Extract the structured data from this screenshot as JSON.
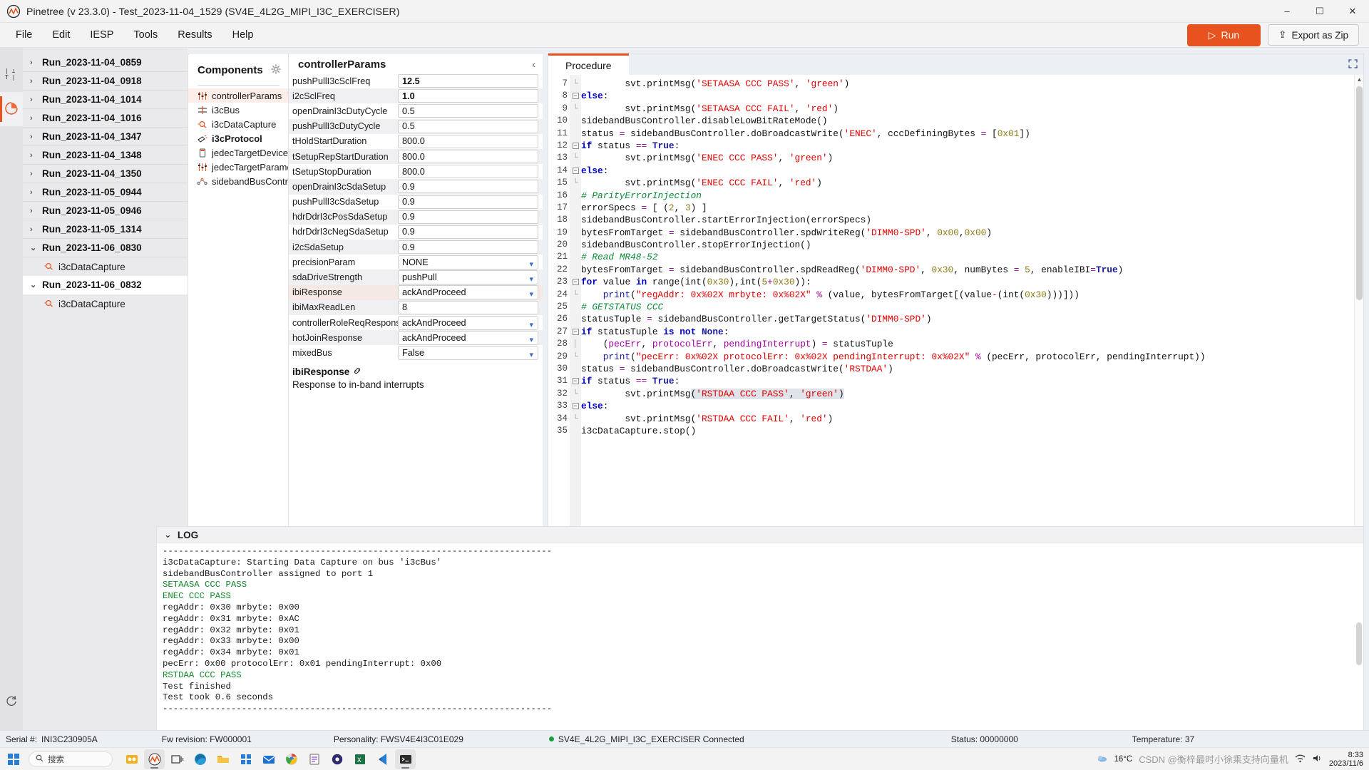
{
  "window": {
    "title": "Pinetree (v 23.3.0) - Test_2023-11-04_1529 (SV4E_4L2G_MIPI_I3C_EXERCISER)",
    "minimize": "–",
    "maximize": "☐",
    "close": "✕"
  },
  "menu": {
    "items": [
      "File",
      "Edit",
      "IESP",
      "Tools",
      "Results",
      "Help"
    ],
    "run_label": "Run",
    "export_label": "Export as Zip"
  },
  "rail": {
    "items": [
      {
        "name": "signal-settings-icon",
        "label": ""
      },
      {
        "name": "results-pie-icon",
        "label": ""
      }
    ],
    "bottom": [
      {
        "name": "refresh-icon"
      },
      {
        "name": "document-icon"
      }
    ]
  },
  "runtree": {
    "runs": [
      {
        "label": "Run_2023-11-04_0859",
        "expanded": false,
        "selected": false,
        "children": []
      },
      {
        "label": "Run_2023-11-04_0918",
        "expanded": false,
        "selected": false,
        "children": []
      },
      {
        "label": "Run_2023-11-04_1014",
        "expanded": false,
        "selected": false,
        "children": []
      },
      {
        "label": "Run_2023-11-04_1016",
        "expanded": false,
        "selected": false,
        "children": []
      },
      {
        "label": "Run_2023-11-04_1347",
        "expanded": false,
        "selected": false,
        "children": []
      },
      {
        "label": "Run_2023-11-04_1348",
        "expanded": false,
        "selected": false,
        "children": []
      },
      {
        "label": "Run_2023-11-04_1350",
        "expanded": false,
        "selected": false,
        "children": []
      },
      {
        "label": "Run_2023-11-05_0944",
        "expanded": false,
        "selected": false,
        "children": []
      },
      {
        "label": "Run_2023-11-05_0946",
        "expanded": false,
        "selected": false,
        "children": []
      },
      {
        "label": "Run_2023-11-05_1314",
        "expanded": false,
        "selected": false,
        "children": []
      },
      {
        "label": "Run_2023-11-06_0830",
        "expanded": true,
        "selected": false,
        "children": [
          "i3cDataCapture"
        ]
      },
      {
        "label": "Run_2023-11-06_0832",
        "expanded": true,
        "selected": true,
        "children": [
          "i3cDataCapture"
        ]
      }
    ]
  },
  "components": {
    "title": "Components",
    "gear_icon": "gear-icon",
    "items": [
      {
        "label": "controllerParams",
        "icon": "sliders-icon",
        "highlighted": true,
        "bold": false,
        "trash": true
      },
      {
        "label": "i3cBus",
        "icon": "bus-icon",
        "highlighted": false,
        "bold": false,
        "trash": false
      },
      {
        "label": "i3cDataCapture",
        "icon": "capture-icon",
        "highlighted": false,
        "bold": false,
        "trash": false
      },
      {
        "label": "i3cProtocol",
        "icon": "protocol-icon",
        "highlighted": false,
        "bold": true,
        "trash": false
      },
      {
        "label": "jedecTargetDevice",
        "icon": "device-icon",
        "highlighted": false,
        "bold": false,
        "trash": false
      },
      {
        "label": "jedecTargetParameters",
        "icon": "sliders-icon",
        "highlighted": false,
        "bold": false,
        "trash": false
      },
      {
        "label": "sidebandBusController",
        "icon": "network-icon",
        "highlighted": false,
        "bold": false,
        "trash": false
      }
    ]
  },
  "params": {
    "title": "controllerParams",
    "collapse_icon": "chevron-left-icon",
    "rows": [
      {
        "name": "pushPullI3cSclFreq",
        "value": "12.5",
        "type": "text",
        "bold": true,
        "highlighted": false
      },
      {
        "name": "i2cSclFreq",
        "value": "1.0",
        "type": "text",
        "bold": true,
        "highlighted": false
      },
      {
        "name": "openDrainI3cDutyCycle",
        "value": "0.5",
        "type": "text",
        "bold": false,
        "highlighted": false
      },
      {
        "name": "pushPullI3cDutyCycle",
        "value": "0.5",
        "type": "text",
        "bold": false,
        "highlighted": false
      },
      {
        "name": "tHoldStartDuration",
        "value": "800.0",
        "type": "text",
        "bold": false,
        "highlighted": false
      },
      {
        "name": "tSetupRepStartDuration",
        "value": "800.0",
        "type": "text",
        "bold": false,
        "highlighted": false
      },
      {
        "name": "tSetupStopDuration",
        "value": "800.0",
        "type": "text",
        "bold": false,
        "highlighted": false
      },
      {
        "name": "openDrainI3cSdaSetup",
        "value": "0.9",
        "type": "text",
        "bold": false,
        "highlighted": false
      },
      {
        "name": "pushPullI3cSdaSetup",
        "value": "0.9",
        "type": "text",
        "bold": false,
        "highlighted": false
      },
      {
        "name": "hdrDdrI3cPosSdaSetup",
        "value": "0.9",
        "type": "text",
        "bold": false,
        "highlighted": false
      },
      {
        "name": "hdrDdrI3cNegSdaSetup",
        "value": "0.9",
        "type": "text",
        "bold": false,
        "highlighted": false
      },
      {
        "name": "i2cSdaSetup",
        "value": "0.9",
        "type": "text",
        "bold": false,
        "highlighted": false
      },
      {
        "name": "precisionParam",
        "value": "NONE",
        "type": "select",
        "bold": false,
        "highlighted": false
      },
      {
        "name": "sdaDriveStrength",
        "value": "pushPull",
        "type": "select",
        "bold": false,
        "highlighted": false
      },
      {
        "name": "ibiResponse",
        "value": "ackAndProceed",
        "type": "select",
        "bold": false,
        "highlighted": true
      },
      {
        "name": "ibiMaxReadLen",
        "value": "8",
        "type": "text",
        "bold": false,
        "highlighted": false
      },
      {
        "name": "controllerRoleReqResponse",
        "value": "ackAndProceed",
        "type": "select",
        "bold": false,
        "highlighted": false
      },
      {
        "name": "hotJoinResponse",
        "value": "ackAndProceed",
        "type": "select",
        "bold": false,
        "highlighted": false
      },
      {
        "name": "mixedBus",
        "value": "False",
        "type": "select",
        "bold": false,
        "highlighted": false
      }
    ],
    "description": {
      "title": "ibiResponse",
      "link_icon": "link-icon",
      "text": "Response to in-band interrupts"
    }
  },
  "procedure": {
    "tab_label": "Procedure",
    "expand_icon": "expand-icon",
    "first_line_number": 7,
    "lines": [
      {
        "n": 7,
        "fold": "end",
        "html": "        svt.printMsg(<span class=\"s\">'SETAASA CCC PASS'</span>, <span class=\"s\">'green'</span>)"
      },
      {
        "n": 8,
        "fold": "box",
        "html": "<span class=\"k\">else</span>:"
      },
      {
        "n": 9,
        "fold": "end",
        "html": "        svt.printMsg(<span class=\"s\">'SETAASA CCC FAIL'</span>, <span class=\"s\">'red'</span>)"
      },
      {
        "n": 10,
        "fold": "",
        "html": "sidebandBusController.disableLowBitRateMode()"
      },
      {
        "n": 11,
        "fold": "",
        "html": "status <span class=\"op\">=</span> sidebandBusController.doBroadcastWrite(<span class=\"s\">'ENEC'</span>, cccDefiningBytes <span class=\"op\">=</span> [<span class=\"n\">0x01</span>])"
      },
      {
        "n": 12,
        "fold": "box",
        "html": "<span class=\"k\">if</span> status <span class=\"op\">==</span> <span class=\"b\">True</span>:"
      },
      {
        "n": 13,
        "fold": "end",
        "html": "        svt.printMsg(<span class=\"s\">'ENEC CCC PASS'</span>, <span class=\"s\">'green'</span>)"
      },
      {
        "n": 14,
        "fold": "box",
        "html": "<span class=\"k\">else</span>:"
      },
      {
        "n": 15,
        "fold": "end",
        "html": "        svt.printMsg(<span class=\"s\">'ENEC CCC FAIL'</span>, <span class=\"s\">'red'</span>)"
      },
      {
        "n": 16,
        "fold": "",
        "html": "<span class=\"c\"># ParityErrorInjection</span>"
      },
      {
        "n": 17,
        "fold": "",
        "html": "errorSpecs <span class=\"op\">=</span> [ (<span class=\"n\">2</span>, <span class=\"n\">3</span>) ]"
      },
      {
        "n": 18,
        "fold": "",
        "html": "sidebandBusController.startErrorInjection(errorSpecs)"
      },
      {
        "n": 19,
        "fold": "",
        "html": "bytesFromTarget <span class=\"op\">=</span> sidebandBusController.spdWriteReg(<span class=\"s\">'DIMM0-SPD'</span>, <span class=\"n\">0x00</span>,<span class=\"n\">0x00</span>)"
      },
      {
        "n": 20,
        "fold": "",
        "html": "sidebandBusController.stopErrorInjection()"
      },
      {
        "n": 21,
        "fold": "",
        "html": "<span class=\"c\"># Read MR48-52</span>"
      },
      {
        "n": 22,
        "fold": "",
        "html": "bytesFromTarget <span class=\"op\">=</span> sidebandBusController.spdReadReg(<span class=\"s\">'DIMM0-SPD'</span>, <span class=\"n\">0x30</span>, numBytes <span class=\"op\">=</span> <span class=\"n\">5</span>, enableIBI<span class=\"op\">=</span><span class=\"b\">True</span>)"
      },
      {
        "n": 23,
        "fold": "box",
        "html": "<span class=\"k\">for</span> value <span class=\"k\">in</span> range(int(<span class=\"n\">0x30</span>),int(<span class=\"n\">5</span><span class=\"op\">+</span><span class=\"n\">0x30</span>)):"
      },
      {
        "n": 24,
        "fold": "end",
        "html": "    <span class=\"f\">print</span>(<span class=\"s\">\"regAddr: 0x%02X mrbyte: 0x%02X\"</span> <span class=\"op\">%</span> (value, bytesFromTarget[(value<span class=\"op\">-</span>(int(<span class=\"n\">0x30</span>)))]))"
      },
      {
        "n": 25,
        "fold": "",
        "html": "<span class=\"c\"># GETSTATUS CCC</span>"
      },
      {
        "n": 26,
        "fold": "",
        "html": "statusTuple <span class=\"op\">=</span> sidebandBusController.getTargetStatus(<span class=\"s\">'DIMM0-SPD'</span>)"
      },
      {
        "n": 27,
        "fold": "box",
        "html": "<span class=\"k\">if</span> statusTuple <span class=\"k\">is</span> <span class=\"k\">not</span> <span class=\"b\">None</span>:"
      },
      {
        "n": 28,
        "fold": "bar",
        "html": "    (<span class=\"op\">pecErr</span>, <span class=\"op\">protocolErr</span>, <span class=\"op\">pendingInterrupt</span>) <span class=\"op\">=</span> statusTuple"
      },
      {
        "n": 29,
        "fold": "end",
        "html": "    <span class=\"f\">print</span>(<span class=\"s\">\"pecErr: 0x%02X protocolErr: 0x%02X pendingInterrupt: 0x%02X\"</span> <span class=\"op\">%</span> (pecErr, protocolErr, pendingInterrupt))"
      },
      {
        "n": 30,
        "fold": "",
        "html": "status <span class=\"op\">=</span> sidebandBusController.doBroadcastWrite(<span class=\"s\">'RSTDAA'</span>)"
      },
      {
        "n": 31,
        "fold": "box",
        "html": "<span class=\"k\">if</span> status <span class=\"op\">==</span> <span class=\"b\">True</span>:"
      },
      {
        "n": 32,
        "fold": "end",
        "html": "        svt.printMsg<span class=\"sel-tok\">(</span><span class=\"s sel-tok\">'RSTDAA CCC PASS'</span><span class=\"sel-tok\">, </span><span class=\"s sel-tok\">'green'</span><span class=\"sel-tok\">)</span>"
      },
      {
        "n": 33,
        "fold": "box",
        "html": "<span class=\"k\">else</span>:"
      },
      {
        "n": 34,
        "fold": "end",
        "html": "        svt.printMsg(<span class=\"s\">'RSTDAA CCC FAIL'</span>, <span class=\"s\">'red'</span>)"
      },
      {
        "n": 35,
        "fold": "",
        "html": "i3cDataCapture.stop()"
      }
    ]
  },
  "log": {
    "title": "LOG",
    "collapse_icon": "chevron-down-icon",
    "lines": [
      {
        "text": "--------------------------------------------------------------------------",
        "color": "default"
      },
      {
        "text": "i3cDataCapture: Starting Data Capture on bus 'i3cBus'",
        "color": "default"
      },
      {
        "text": "sidebandBusController assigned to port 1",
        "color": "default"
      },
      {
        "text": "SETAASA CCC PASS",
        "color": "green"
      },
      {
        "text": "ENEC CCC PASS",
        "color": "green"
      },
      {
        "text": "regAddr: 0x30 mrbyte: 0x00",
        "color": "default"
      },
      {
        "text": "regAddr: 0x31 mrbyte: 0xAC",
        "color": "default"
      },
      {
        "text": "regAddr: 0x32 mrbyte: 0x01",
        "color": "default"
      },
      {
        "text": "regAddr: 0x33 mrbyte: 0x00",
        "color": "default"
      },
      {
        "text": "regAddr: 0x34 mrbyte: 0x01",
        "color": "default"
      },
      {
        "text": "pecErr: 0x00 protocolErr: 0x01 pendingInterrupt: 0x00",
        "color": "default"
      },
      {
        "text": "RSTDAA CCC PASS",
        "color": "green"
      },
      {
        "text": "Test finished",
        "color": "default"
      },
      {
        "text": "Test took 0.6 seconds",
        "color": "default"
      },
      {
        "text": "--------------------------------------------------------------------------",
        "color": "default"
      }
    ]
  },
  "statusbar": {
    "serial_label": "Serial #:",
    "serial_value": "INI3C230905A",
    "fw_revision": "Fw revision: FW000001",
    "personality": "Personality: FWSV4E4I3C01E029",
    "connection": "SV4E_4L2G_MIPI_I3C_EXERCISER Connected",
    "status": "Status: 00000000",
    "temperature": "Temperature: 37"
  },
  "taskbar": {
    "search_placeholder": "搜索",
    "weather": "16°C",
    "clock_time": "8:33",
    "clock_date": "2023/11/6",
    "icons": [
      "start-icon",
      "search-icon",
      "teams-icon",
      "pinetree-taskbar-icon",
      "taskview-icon",
      "edge-icon",
      "explorer-icon",
      "store-icon",
      "mail-icon",
      "chrome-icon",
      "notes-icon",
      "settings-icon",
      "excel-icon",
      "vscode-icon",
      "terminal-icon"
    ],
    "watermark": "CSDN @衡梓最时小徐乘支持向量机"
  }
}
